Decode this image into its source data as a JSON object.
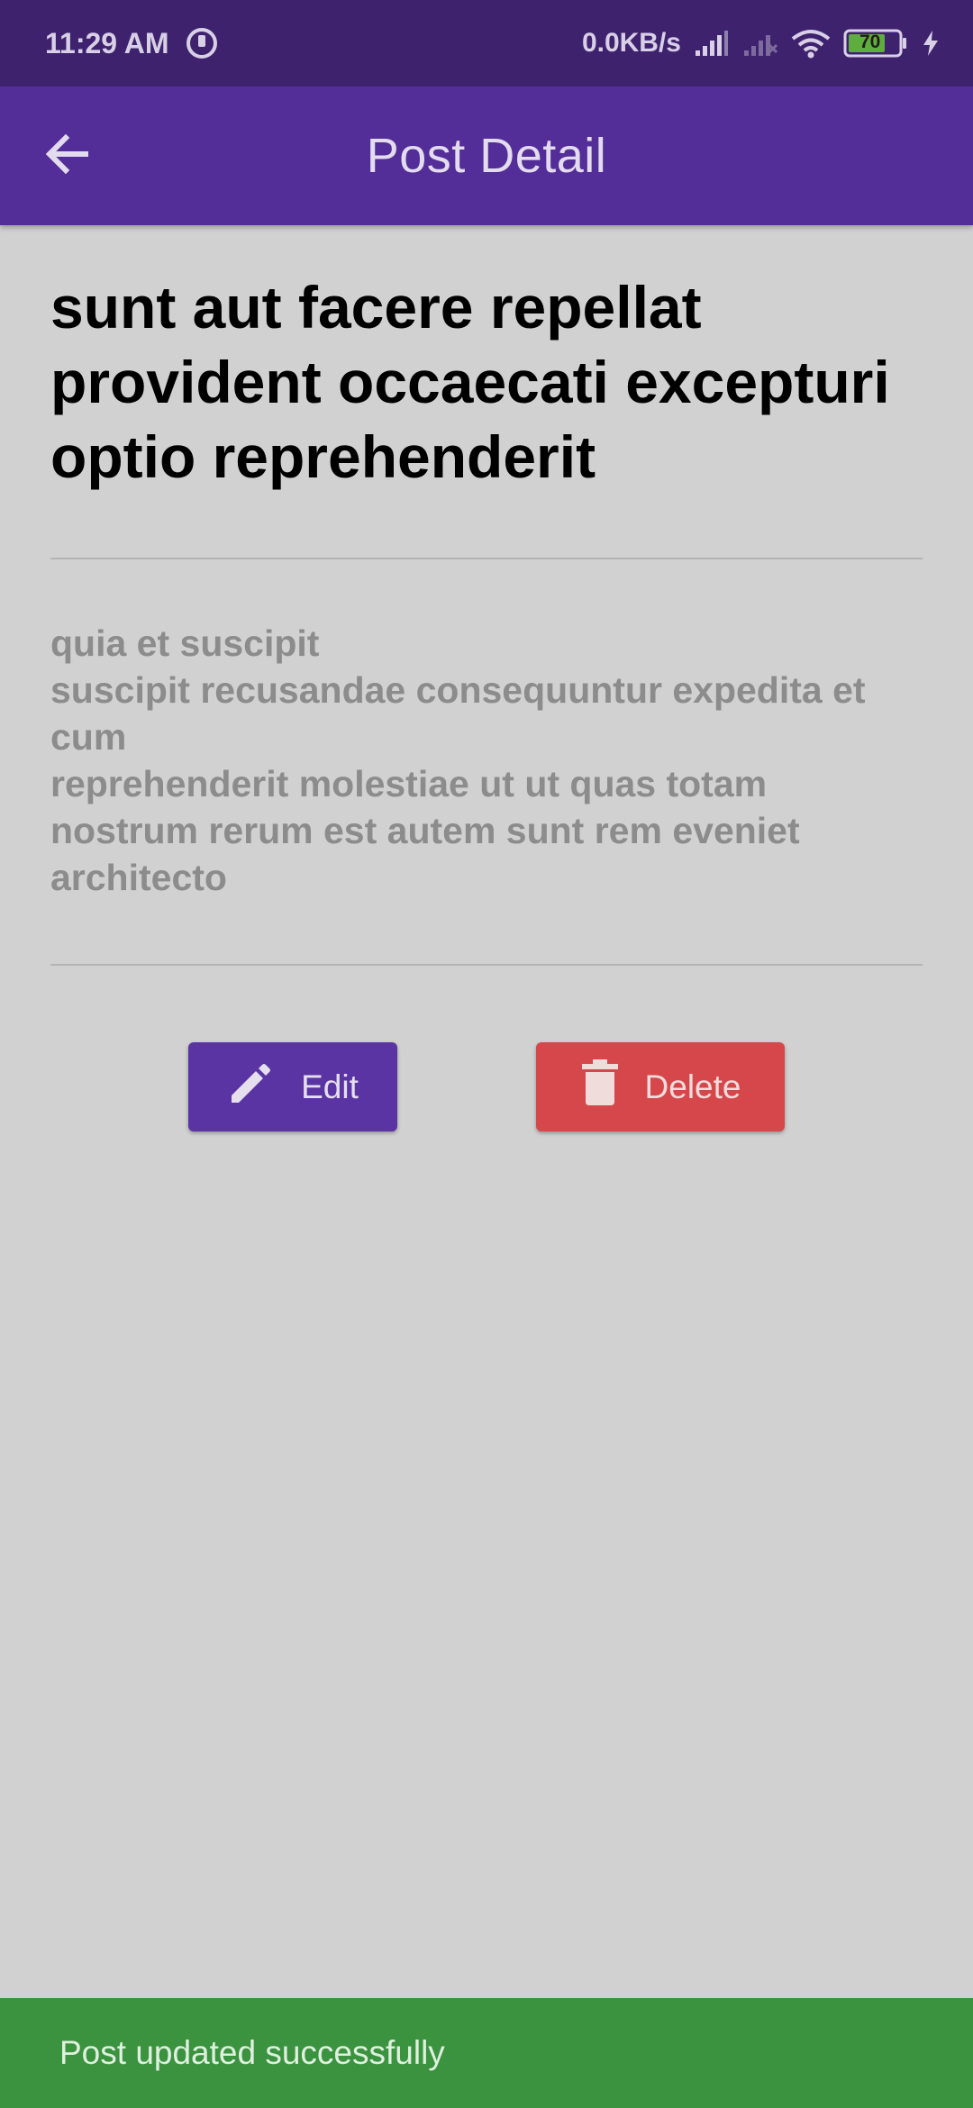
{
  "status_bar": {
    "time": "11:29 AM",
    "network_speed": "0.0KB/s",
    "battery_level": "70",
    "icons": [
      "sync-icon",
      "signal-icon",
      "signal-off-icon",
      "wifi-icon",
      "battery-icon",
      "charging-icon"
    ]
  },
  "app_bar": {
    "title": "Post Detail",
    "back_icon": "arrow-back-icon"
  },
  "post": {
    "title": "sunt aut facere repellat provident occaecati excepturi optio reprehenderit",
    "body": "quia et suscipit\nsuscipit recusandae consequuntur expedita et cum\nreprehenderit molestiae ut ut quas totam\nnostrum rerum est autem sunt rem eveniet architecto"
  },
  "actions": {
    "edit_label": "Edit",
    "edit_icon": "pencil-icon",
    "delete_label": "Delete",
    "delete_icon": "trash-icon"
  },
  "snackbar": {
    "message": "Post updated successfully"
  },
  "colors": {
    "status_bar": "#3f226e",
    "app_bar": "#532d98",
    "background": "#d1d1d1",
    "edit_button": "#5a34a3",
    "delete_button": "#d5474a",
    "snackbar": "#3b923f"
  }
}
